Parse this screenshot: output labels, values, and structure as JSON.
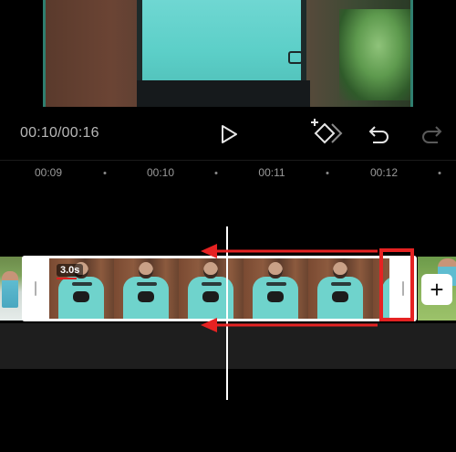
{
  "player": {
    "time": "00:10/00:16"
  },
  "controls": {
    "play": "play-icon",
    "keyframe": "add-keyframe-icon",
    "undo": "undo-icon",
    "redo": "redo-icon"
  },
  "ruler": {
    "labels": [
      "00:09",
      "00:10",
      "00:11",
      "00:12"
    ]
  },
  "clip": {
    "duration": "3.0s"
  },
  "annotation": {
    "color": "#e52222"
  },
  "add_clip": {
    "label": "+"
  }
}
